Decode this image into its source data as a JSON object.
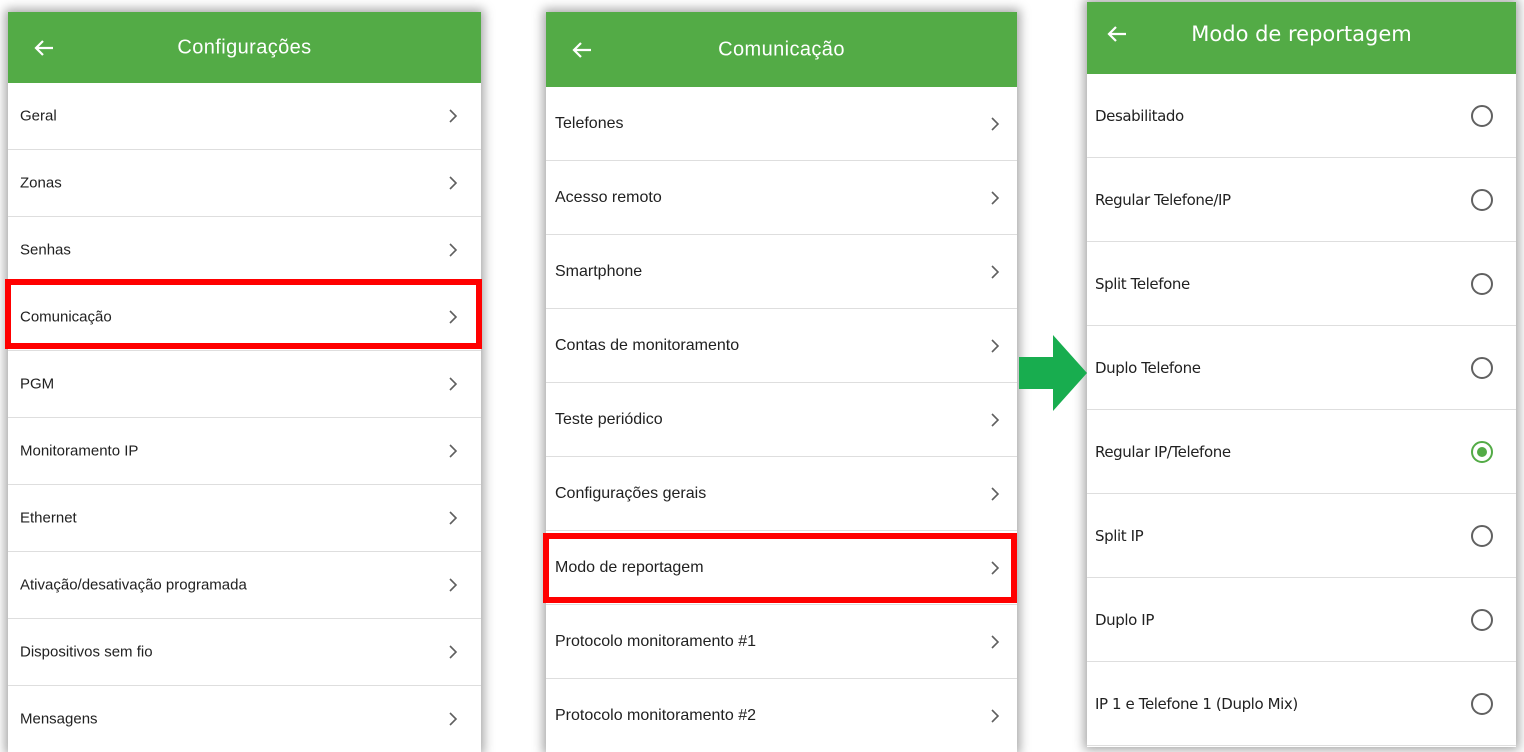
{
  "screens": [
    {
      "title": "Configurações",
      "items": [
        "Geral",
        "Zonas",
        "Senhas",
        "Comunicação",
        "PGM",
        "Monitoramento IP",
        "Ethernet",
        "Ativação/desativação programada",
        "Dispositivos sem fio",
        "Mensagens"
      ],
      "highlighted_item": "Comunicação"
    },
    {
      "title": "Comunicação",
      "items": [
        "Telefones",
        "Acesso remoto",
        "Smartphone",
        "Contas de monitoramento",
        "Teste periódico",
        "Configurações gerais",
        "Modo de reportagem",
        "Protocolo monitoramento #1",
        "Protocolo monitoramento #2"
      ],
      "highlighted_item": "Modo de reportagem"
    },
    {
      "title": "Modo de reportagem",
      "options": [
        "Desabilitado",
        "Regular Telefone/IP",
        "Split Telefone",
        "Duplo Telefone",
        "Regular IP/Telefone",
        "Split IP",
        "Duplo IP",
        "IP 1 e Telefone 1 (Duplo Mix)"
      ],
      "selected_option": "Regular IP/Telefone"
    }
  ],
  "icons": {
    "back": "back-arrow-icon",
    "chevron": "chevron-right-icon",
    "radio": "radio-button-icon",
    "flow_arrow": "green-right-arrow-icon"
  },
  "colors": {
    "header": "#53ab46",
    "highlight": "#ff0000",
    "flow_arrow": "#18ad4f",
    "radio_selected": "#53ab46"
  }
}
